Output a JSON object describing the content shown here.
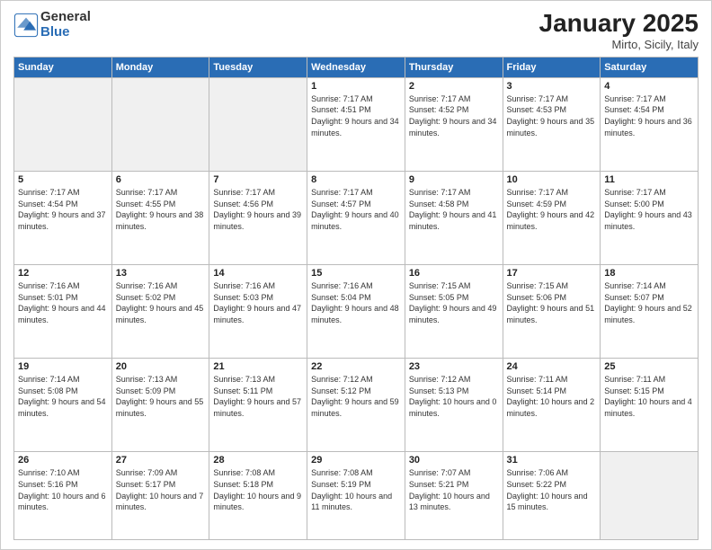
{
  "logo": {
    "general": "General",
    "blue": "Blue"
  },
  "header": {
    "month": "January 2025",
    "location": "Mirto, Sicily, Italy"
  },
  "weekdays": [
    "Sunday",
    "Monday",
    "Tuesday",
    "Wednesday",
    "Thursday",
    "Friday",
    "Saturday"
  ],
  "weeks": [
    [
      {
        "day": "",
        "empty": true
      },
      {
        "day": "",
        "empty": true
      },
      {
        "day": "",
        "empty": true
      },
      {
        "day": "1",
        "sunrise": "7:17 AM",
        "sunset": "4:51 PM",
        "daylight": "9 hours and 34 minutes."
      },
      {
        "day": "2",
        "sunrise": "7:17 AM",
        "sunset": "4:52 PM",
        "daylight": "9 hours and 34 minutes."
      },
      {
        "day": "3",
        "sunrise": "7:17 AM",
        "sunset": "4:53 PM",
        "daylight": "9 hours and 35 minutes."
      },
      {
        "day": "4",
        "sunrise": "7:17 AM",
        "sunset": "4:54 PM",
        "daylight": "9 hours and 36 minutes."
      }
    ],
    [
      {
        "day": "5",
        "sunrise": "7:17 AM",
        "sunset": "4:54 PM",
        "daylight": "9 hours and 37 minutes."
      },
      {
        "day": "6",
        "sunrise": "7:17 AM",
        "sunset": "4:55 PM",
        "daylight": "9 hours and 38 minutes."
      },
      {
        "day": "7",
        "sunrise": "7:17 AM",
        "sunset": "4:56 PM",
        "daylight": "9 hours and 39 minutes."
      },
      {
        "day": "8",
        "sunrise": "7:17 AM",
        "sunset": "4:57 PM",
        "daylight": "9 hours and 40 minutes."
      },
      {
        "day": "9",
        "sunrise": "7:17 AM",
        "sunset": "4:58 PM",
        "daylight": "9 hours and 41 minutes."
      },
      {
        "day": "10",
        "sunrise": "7:17 AM",
        "sunset": "4:59 PM",
        "daylight": "9 hours and 42 minutes."
      },
      {
        "day": "11",
        "sunrise": "7:17 AM",
        "sunset": "5:00 PM",
        "daylight": "9 hours and 43 minutes."
      }
    ],
    [
      {
        "day": "12",
        "sunrise": "7:16 AM",
        "sunset": "5:01 PM",
        "daylight": "9 hours and 44 minutes."
      },
      {
        "day": "13",
        "sunrise": "7:16 AM",
        "sunset": "5:02 PM",
        "daylight": "9 hours and 45 minutes."
      },
      {
        "day": "14",
        "sunrise": "7:16 AM",
        "sunset": "5:03 PM",
        "daylight": "9 hours and 47 minutes."
      },
      {
        "day": "15",
        "sunrise": "7:16 AM",
        "sunset": "5:04 PM",
        "daylight": "9 hours and 48 minutes."
      },
      {
        "day": "16",
        "sunrise": "7:15 AM",
        "sunset": "5:05 PM",
        "daylight": "9 hours and 49 minutes."
      },
      {
        "day": "17",
        "sunrise": "7:15 AM",
        "sunset": "5:06 PM",
        "daylight": "9 hours and 51 minutes."
      },
      {
        "day": "18",
        "sunrise": "7:14 AM",
        "sunset": "5:07 PM",
        "daylight": "9 hours and 52 minutes."
      }
    ],
    [
      {
        "day": "19",
        "sunrise": "7:14 AM",
        "sunset": "5:08 PM",
        "daylight": "9 hours and 54 minutes."
      },
      {
        "day": "20",
        "sunrise": "7:13 AM",
        "sunset": "5:09 PM",
        "daylight": "9 hours and 55 minutes."
      },
      {
        "day": "21",
        "sunrise": "7:13 AM",
        "sunset": "5:11 PM",
        "daylight": "9 hours and 57 minutes."
      },
      {
        "day": "22",
        "sunrise": "7:12 AM",
        "sunset": "5:12 PM",
        "daylight": "9 hours and 59 minutes."
      },
      {
        "day": "23",
        "sunrise": "7:12 AM",
        "sunset": "5:13 PM",
        "daylight": "10 hours and 0 minutes."
      },
      {
        "day": "24",
        "sunrise": "7:11 AM",
        "sunset": "5:14 PM",
        "daylight": "10 hours and 2 minutes."
      },
      {
        "day": "25",
        "sunrise": "7:11 AM",
        "sunset": "5:15 PM",
        "daylight": "10 hours and 4 minutes."
      }
    ],
    [
      {
        "day": "26",
        "sunrise": "7:10 AM",
        "sunset": "5:16 PM",
        "daylight": "10 hours and 6 minutes."
      },
      {
        "day": "27",
        "sunrise": "7:09 AM",
        "sunset": "5:17 PM",
        "daylight": "10 hours and 7 minutes."
      },
      {
        "day": "28",
        "sunrise": "7:08 AM",
        "sunset": "5:18 PM",
        "daylight": "10 hours and 9 minutes."
      },
      {
        "day": "29",
        "sunrise": "7:08 AM",
        "sunset": "5:19 PM",
        "daylight": "10 hours and 11 minutes."
      },
      {
        "day": "30",
        "sunrise": "7:07 AM",
        "sunset": "5:21 PM",
        "daylight": "10 hours and 13 minutes."
      },
      {
        "day": "31",
        "sunrise": "7:06 AM",
        "sunset": "5:22 PM",
        "daylight": "10 hours and 15 minutes."
      },
      {
        "day": "",
        "empty": true
      }
    ]
  ],
  "labels": {
    "sunrise": "Sunrise:",
    "sunset": "Sunset:",
    "daylight": "Daylight:"
  }
}
